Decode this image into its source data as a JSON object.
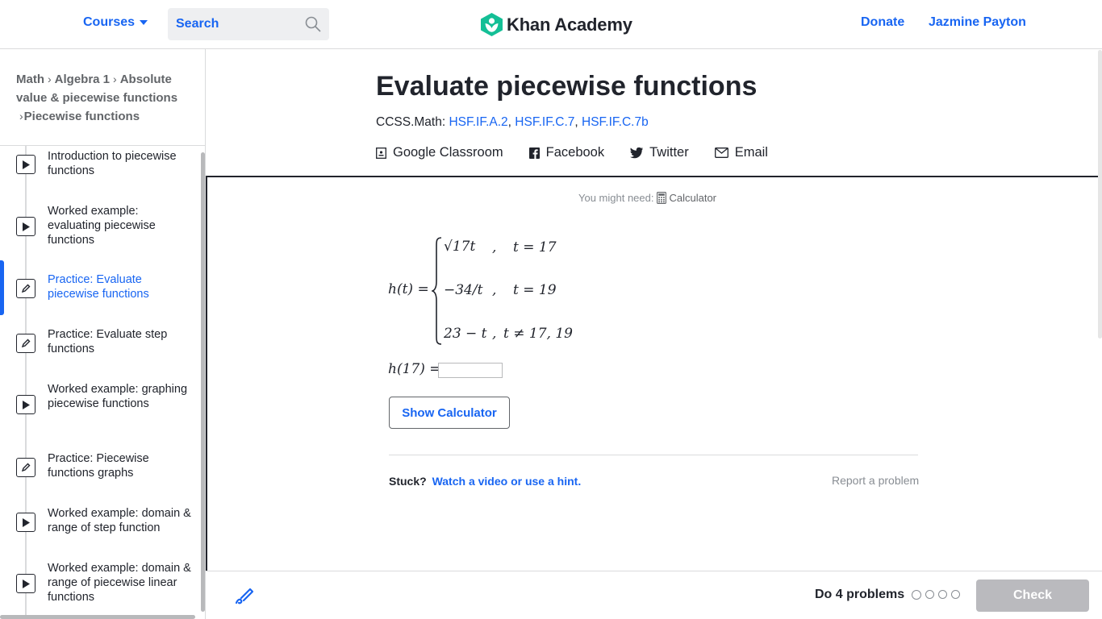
{
  "header": {
    "courses_label": "Courses",
    "search_placeholder": "Search",
    "logo_text": "Khan Academy",
    "donate_label": "Donate",
    "user_name": "Jazmine Payton"
  },
  "breadcrumb": {
    "items": [
      "Math",
      "Algebra 1",
      "Absolute value & piecewise functions",
      "Piecewise functions"
    ]
  },
  "sidebar": {
    "items": [
      {
        "label": "Introduction to piecewise functions",
        "type": "video-icon",
        "active": false
      },
      {
        "label": "Worked example: evaluating piecewise functions",
        "type": "video-icon",
        "active": false
      },
      {
        "label": "Practice: Evaluate piecewise functions",
        "type": "pencil-icon",
        "active": true
      },
      {
        "label": "Practice: Evaluate step functions",
        "type": "pencil-icon",
        "active": false
      },
      {
        "label": "Worked example: graphing piecewise functions",
        "type": "video-icon",
        "active": false
      },
      {
        "label": "Practice: Piecewise functions graphs",
        "type": "pencil-icon",
        "active": false
      },
      {
        "label": "Worked example: domain & range of step function",
        "type": "video-icon",
        "active": false
      },
      {
        "label": "Worked example: domain & range of piecewise linear functions",
        "type": "video-icon",
        "active": false
      }
    ]
  },
  "page": {
    "title": "Evaluate piecewise functions",
    "ccss_prefix": "CCSS.Math:",
    "ccss_codes": [
      "HSF.IF.A.2",
      "HSF.IF.C.7",
      "HSF.IF.C.7b"
    ],
    "share": {
      "google": "Google Classroom",
      "facebook": "Facebook",
      "twitter": "Twitter",
      "email": "Email"
    }
  },
  "exercise": {
    "you_might_need": "You might need:",
    "calculator": "Calculator",
    "function_lhs": "h(t) =",
    "cases": [
      {
        "expr": "√17t",
        "cond": "t = 17"
      },
      {
        "expr": "−34/t",
        "cond": "t = 19"
      },
      {
        "expr": "23 − t",
        "cond": "t ≠ 17, 19"
      }
    ],
    "question_lhs": "h(17) =",
    "answer_value": "",
    "show_calculator": "Show Calculator",
    "stuck": "Stuck?",
    "hint_link": "Watch a video or use a hint.",
    "report": "Report a problem"
  },
  "footer": {
    "do_problems": "Do 4 problems",
    "progress_dots": 4,
    "check_label": "Check"
  }
}
